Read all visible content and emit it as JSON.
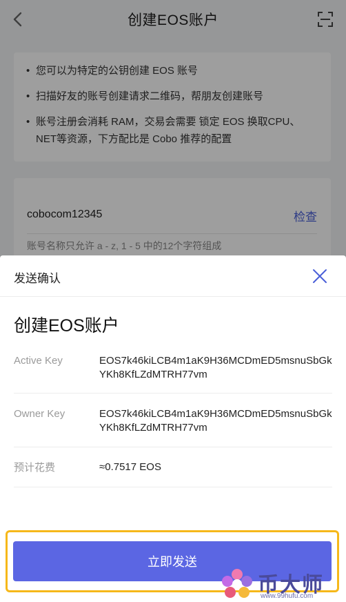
{
  "nav": {
    "title": "创建EOS账户",
    "back_icon": "chevron-left-icon",
    "scan_icon": "scan-icon"
  },
  "info": {
    "bullet": "•",
    "lines": [
      "您可以为特定的公钥创建 EOS 账号",
      "扫描好友的账号创建请求二维码，帮朋友创建账号",
      "账号注册会消耗 RAM，交易会需要 锁定 EOS 换取CPU、NET等资源，下方配比是 Cobo 推荐的配置"
    ]
  },
  "account": {
    "name": "cobocom12345",
    "check_label": "检查",
    "rule": "账号名称只允许 a - z, 1 - 5 中的12个字符组成"
  },
  "sheet": {
    "title": "发送确认",
    "close_icon": "close-icon",
    "heading": "创建EOS账户",
    "rows": [
      {
        "label": "Active Key",
        "value": "EOS7k46kiLCB4m1aK9H36MCDmED5msnuSbGkYKh8KfLZdMTRH77vm"
      },
      {
        "label": "Owner Key",
        "value": "EOS7k46kiLCB4m1aK9H36MCDmED5msnuSbGkYKh8KfLZdMTRH77vm"
      },
      {
        "label": "预计花费",
        "value": "≈0.7517 EOS"
      }
    ],
    "send_label": "立即发送"
  },
  "watermark": {
    "text": "币大师",
    "url": "www.99hufu.com"
  },
  "colors": {
    "accent": "#5b66e3",
    "link": "#4a5fd8",
    "highlight_frame": "#f6b81a"
  }
}
